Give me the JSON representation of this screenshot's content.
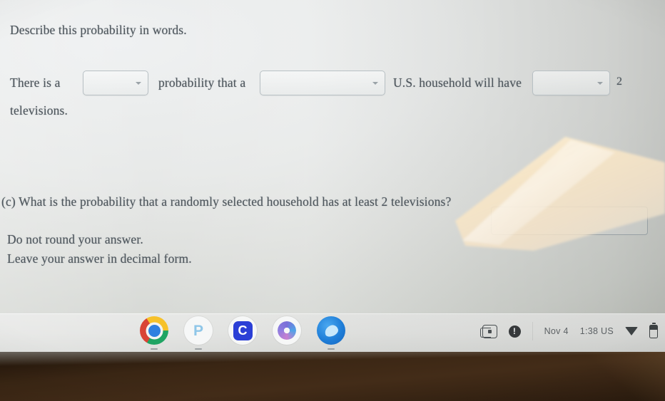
{
  "document": {
    "prompt": "Describe this probability in words.",
    "sentence": {
      "lead": "There is a",
      "middle": "probability that a",
      "tail": "U.S. household will have",
      "count": "2",
      "closing": "televisions."
    },
    "question_c": "(c) What is the probability that a randomly selected household has at least 2 televisions?",
    "instruction_1": "Do not round your answer.",
    "instruction_2": "Leave your answer in decimal form."
  },
  "controls": {
    "dropdown_probability": {
      "name": "probability-word-dropdown",
      "value": "",
      "caret": "chevron-down-icon"
    },
    "dropdown_qualifier": {
      "name": "qualifier-dropdown",
      "value": "",
      "caret": "chevron-down-icon"
    },
    "dropdown_comparison": {
      "name": "comparison-dropdown",
      "value": "",
      "caret": "chevron-down-icon"
    },
    "answer_input": {
      "name": "answer-input",
      "value": "",
      "placeholder": ""
    }
  },
  "shelf": {
    "apps": [
      {
        "name": "chrome-icon",
        "label": "Chrome"
      },
      {
        "name": "pages-icon",
        "label": "P"
      },
      {
        "name": "canvas-icon",
        "label": "C"
      },
      {
        "name": "photos-icon",
        "label": "Photos"
      },
      {
        "name": "bluebird-icon",
        "label": "App"
      }
    ],
    "status": {
      "capture_icon": "screen-capture-icon",
      "alert_icon": "notification-alert-icon",
      "date": "Nov 4",
      "time": "1:38 US",
      "wifi_icon": "wifi-icon",
      "battery_icon": "battery-icon"
    }
  },
  "colors": {
    "screen_bg": "#e3e5e3",
    "text": "#4e565c",
    "shelf_bg": "#dfe0de",
    "desk": "#3a2614",
    "glare": "#f7e7c9",
    "chrome_blue": "#2f7fe0",
    "canvas_blue": "#2b3fd6"
  }
}
